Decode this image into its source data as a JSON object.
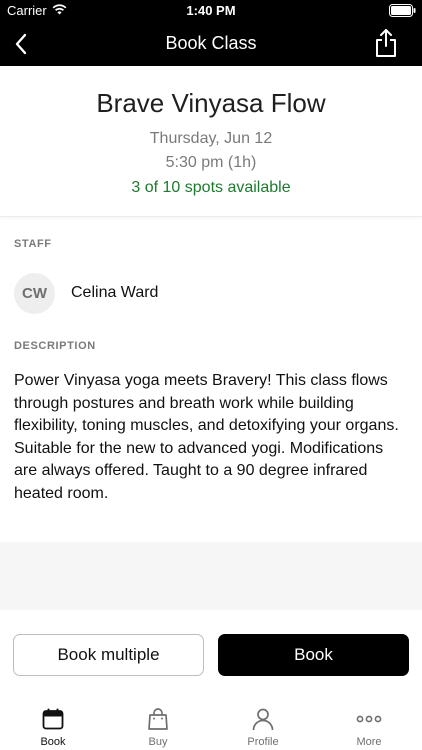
{
  "status_bar": {
    "carrier": "Carrier",
    "time": "1:40 PM"
  },
  "nav": {
    "title": "Book Class",
    "back_icon": "chevron-left-icon",
    "share_icon": "share-icon"
  },
  "class_info": {
    "name": "Brave Vinyasa Flow",
    "date": "Thursday, Jun 12",
    "time": "5:30 pm (1h)",
    "availability": "3 of 10 spots available",
    "availability_color": "#1e7a2e"
  },
  "staff": {
    "label": "STAFF",
    "initials": "CW",
    "name": "Celina Ward"
  },
  "description": {
    "label": "DESCRIPTION",
    "text": "Power Vinyasa yoga meets Bravery! This class flows through postures and breath work while building flexibility, toning muscles, and detoxifying your organs. Suitable for the new to advanced yogi. Modifications are always offered.  Taught to a 90 degree infrared heated room."
  },
  "actions": {
    "book_multiple": "Book multiple",
    "book": "Book"
  },
  "tabs": [
    {
      "label": "Book",
      "icon": "calendar-icon",
      "active": true
    },
    {
      "label": "Buy",
      "icon": "shopping-bag-icon",
      "active": false
    },
    {
      "label": "Profile",
      "icon": "person-icon",
      "active": false
    },
    {
      "label": "More",
      "icon": "ellipsis-icon",
      "active": false
    }
  ]
}
